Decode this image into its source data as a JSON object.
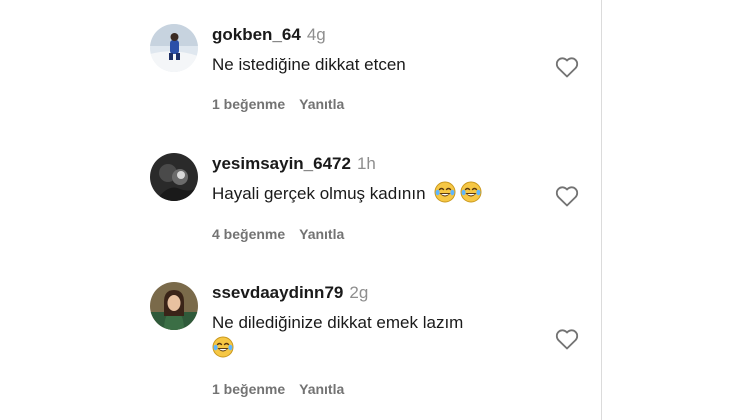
{
  "comments": [
    {
      "username": "gokben_64",
      "time": "4g",
      "text": "Ne istediğine dikkat etcen",
      "likes": "1 beğenme",
      "reply": "Yanıtla",
      "emojis": 0,
      "avatar_icon": "snow-photo-avatar"
    },
    {
      "username": "yesimsayin_6472",
      "time": "1h",
      "text": "Hayali gerçek olmuş kadının",
      "likes": "4 beğenme",
      "reply": "Yanıtla",
      "emojis": 2,
      "avatar_icon": "dark-photo-avatar"
    },
    {
      "username": "ssevdaaydinn79",
      "time": "2g",
      "text": "Ne dilediğinize dikkat emek lazım",
      "likes": "1 beğenme",
      "reply": "Yanıtla",
      "emojis": 1,
      "avatar_icon": "portrait-avatar"
    }
  ],
  "icons": {
    "like": "heart-outline-icon",
    "emoji": "face-with-tears-of-joy-emoji"
  },
  "colors": {
    "secondary_text": "#737373",
    "time_text": "#8e8e8e",
    "heart_stroke": "#737373",
    "emoji_face": "#f6c744"
  }
}
